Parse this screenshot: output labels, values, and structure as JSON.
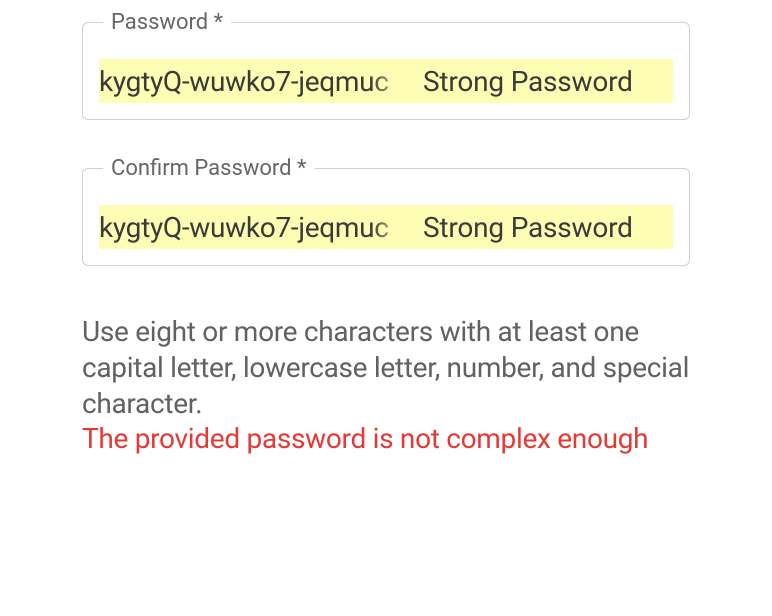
{
  "password_field": {
    "label": "Password *",
    "value": "kygtyQ-wuwko7-jeqmuc",
    "strength": "Strong Password"
  },
  "confirm_field": {
    "label": "Confirm Password *",
    "value": "kygtyQ-wuwko7-jeqmuc",
    "strength": "Strong Password"
  },
  "help_text": "Use eight or more characters with at least one capital letter, lowercase letter, number, and special character.",
  "error_text": "The provided password is not complex enough"
}
